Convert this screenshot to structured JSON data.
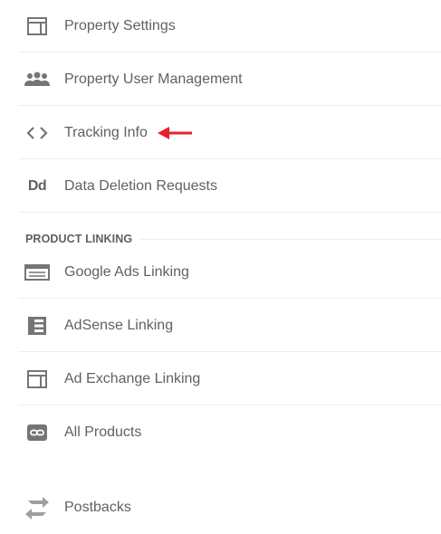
{
  "menu": {
    "property_items": [
      {
        "label": "Property Settings",
        "icon": "property-settings-icon"
      },
      {
        "label": "Property User Management",
        "icon": "users-icon"
      },
      {
        "label": "Tracking Info",
        "icon": "code-brackets-icon"
      },
      {
        "label": "Data Deletion Requests",
        "icon": "data-deletion-icon",
        "icon_text": "Dd"
      }
    ],
    "section_title": "PRODUCT LINKING",
    "linking_items": [
      {
        "label": "Google Ads Linking",
        "icon": "google-ads-icon"
      },
      {
        "label": "AdSense Linking",
        "icon": "adsense-icon"
      },
      {
        "label": "Ad Exchange Linking",
        "icon": "ad-exchange-icon"
      },
      {
        "label": "All Products",
        "icon": "link-icon"
      }
    ],
    "other_items": [
      {
        "label": "Postbacks",
        "icon": "postbacks-icon"
      }
    ]
  },
  "annotation": {
    "arrow_color": "#e8202a",
    "points_to": "Tracking Info"
  },
  "colors": {
    "text": "#616161",
    "icon": "#757575",
    "divider": "#eeeeee"
  }
}
